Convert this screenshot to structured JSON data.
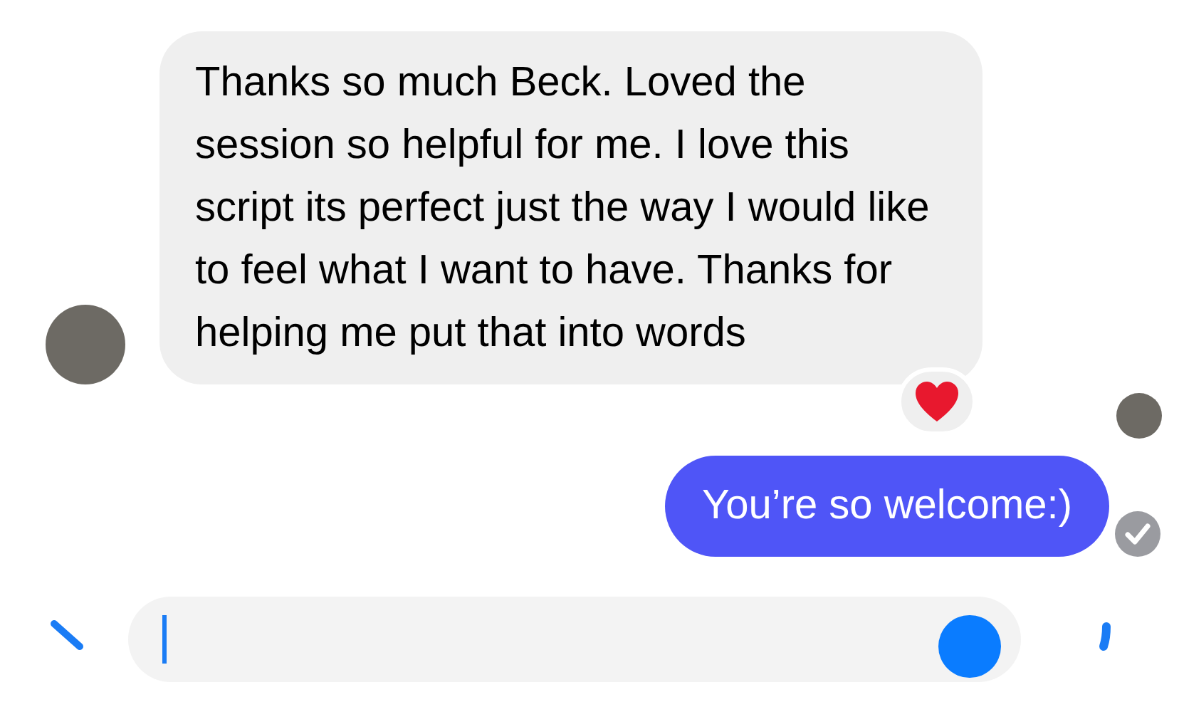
{
  "messages": [
    {
      "kind": "received",
      "text": "Thanks so much Beck. Loved the session so helpful for me. I love this script its perfect just the way I would like to feel what I want to have. Thanks for helping me put that into words",
      "reacted": true,
      "seen": true
    },
    {
      "kind": "sent",
      "text": "You’re so welcome:)",
      "delivered": true
    }
  ]
}
